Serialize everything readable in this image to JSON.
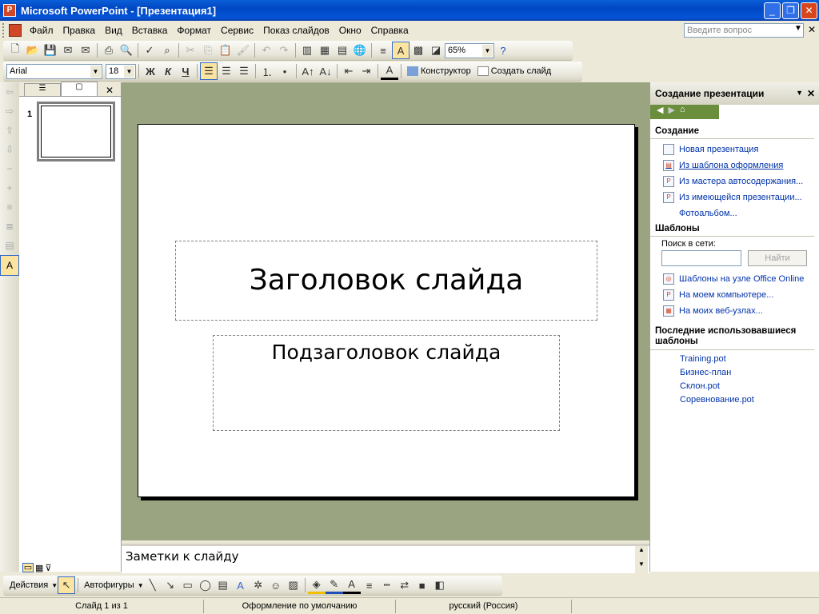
{
  "window": {
    "title": "Microsoft PowerPoint - [Презентация1]"
  },
  "menu": {
    "items": [
      "Файл",
      "Правка",
      "Вид",
      "Вставка",
      "Формат",
      "Сервис",
      "Показ слайдов",
      "Окно",
      "Справка"
    ],
    "ask_placeholder": "Введите вопрос"
  },
  "toolbar": {
    "zoom": "65%"
  },
  "format_toolbar": {
    "font": "Arial",
    "size": "18",
    "bold": "Ж",
    "italic": "К",
    "underline": "Ч",
    "designer": "Конструктор",
    "new_slide": "Создать слайд"
  },
  "thumbs": {
    "slide_number": "1"
  },
  "slide": {
    "title": "Заголовок слайда",
    "subtitle": "Подзаголовок слайда"
  },
  "notes": {
    "placeholder": "Заметки к слайду"
  },
  "taskpane": {
    "title": "Создание презентации",
    "section_create": "Создание",
    "links": [
      "Новая презентация",
      "Из шаблона оформления",
      "Из мастера автосодержания...",
      "Из имеющейся презентации...",
      "Фотоальбом..."
    ],
    "section_templates": "Шаблоны",
    "search_label": "Поиск в сети:",
    "search_button": "Найти",
    "template_links": [
      "Шаблоны на узле Office Online",
      "На моем компьютере...",
      "На моих веб-узлах..."
    ],
    "section_recent": "Последние использовавшиеся шаблоны",
    "recent": [
      "Training.pot",
      "Бизнес-план",
      "Склон.pot",
      "Соревнование.pot"
    ]
  },
  "drawbar": {
    "actions": "Действия",
    "autoshapes": "Автофигуры"
  },
  "status": {
    "slide": "Слайд 1 из 1",
    "design": "Оформление по умолчанию",
    "language": "русский (Россия)"
  }
}
